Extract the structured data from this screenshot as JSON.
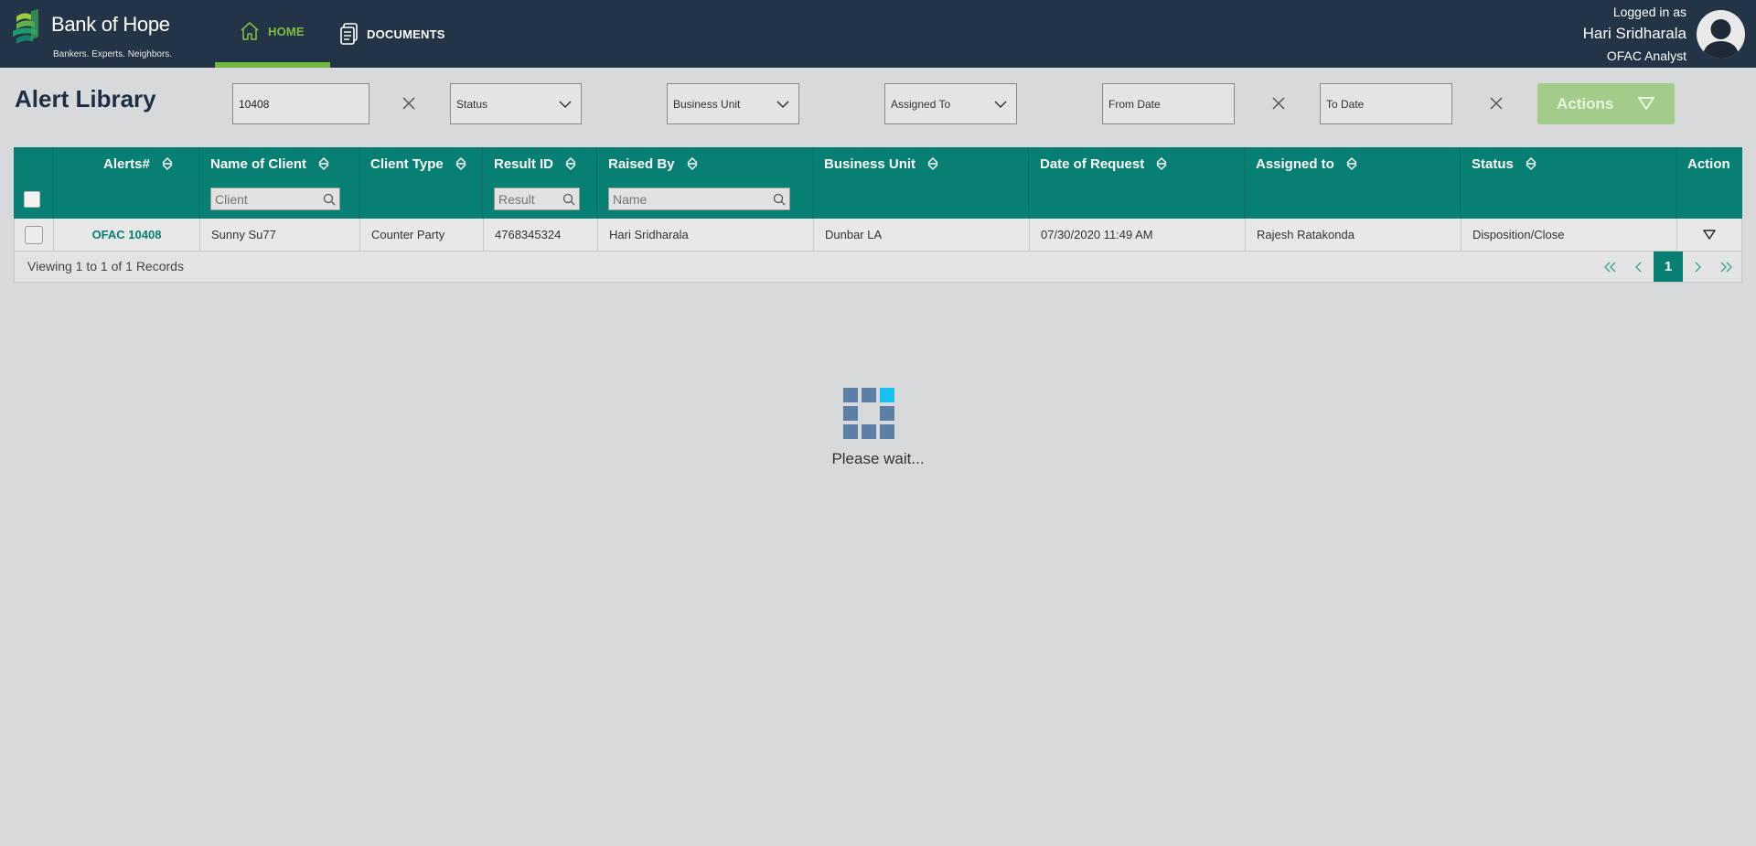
{
  "brand": {
    "name": "Bank of Hope",
    "tagline": "Bankers. Experts. Neighbors."
  },
  "nav": [
    {
      "label": "HOME",
      "icon": "home-icon",
      "active": true
    },
    {
      "label": "DOCUMENTS",
      "icon": "documents-icon",
      "active": false
    }
  ],
  "user": {
    "logged_in_label": "Logged in as",
    "name": "Hari Sridharala",
    "role": "OFAC Analyst"
  },
  "page": {
    "title": "Alert Library"
  },
  "filters": {
    "search_value": "10408",
    "status": "Status",
    "business_unit": "Business Unit",
    "assigned_to": "Assigned To",
    "from_date": "From Date",
    "to_date": "To Date",
    "actions_label": "Actions"
  },
  "table": {
    "columns": [
      "Alerts#",
      "Name of Client",
      "Client Type",
      "Result ID",
      "Raised By",
      "Business Unit",
      "Date of Request",
      "Assigned to",
      "Status",
      "Action"
    ],
    "search_placeholders": {
      "client": "Client",
      "result": "Result",
      "name": "Name"
    },
    "rows": [
      {
        "alert": "OFAC 10408",
        "client": "Sunny Su77",
        "client_type": "Counter Party",
        "result_id": "4768345324",
        "raised_by": "Hari Sridharala",
        "business_unit": "Dunbar LA",
        "date": "07/30/2020 11:49 AM",
        "assigned_to": "Rajesh Ratakonda",
        "status": "Disposition/Close"
      }
    ],
    "footer": "Viewing 1 to 1 of 1 Records",
    "pager": {
      "first": "«",
      "prev": "‹",
      "current": "1",
      "next": "›",
      "last": "»"
    }
  },
  "loading": {
    "text": "Please wait..."
  },
  "colors": {
    "header_bg": "#243447",
    "accent_green": "#74b73e",
    "table_teal": "#077f72",
    "actions_disabled": "#a3cc8b"
  }
}
